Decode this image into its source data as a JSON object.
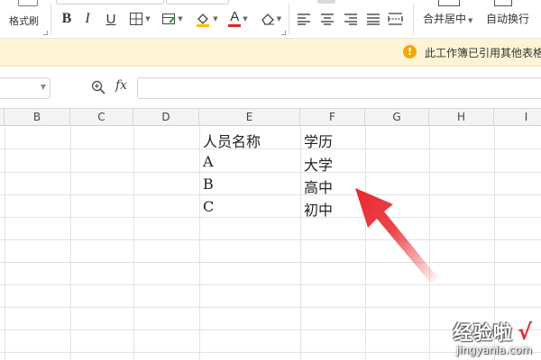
{
  "ribbon": {
    "format_painter_label": "格式刷",
    "bold_label": "B",
    "italic_label": "I",
    "underline_label": "U",
    "font_color_label": "A",
    "font_color": "#e02020",
    "merge_center_label": "合并居中",
    "wrap_text_label": "自动换行",
    "icons": [
      "format-painter-icon",
      "border-icon",
      "cell-style-icon",
      "fill-color-icon",
      "font-color-icon",
      "clear-icon",
      "align-left-icon",
      "align-center-icon",
      "align-right-icon",
      "justify-icon",
      "distribute-icon",
      "merge-icon",
      "wrap-icon"
    ]
  },
  "notice": {
    "text": "此工作簿已引用其他表格",
    "icon": "warning-icon",
    "icon_color": "#f2a900",
    "bg_color": "#fdf4d6"
  },
  "formula_bar": {
    "name_box_value": "",
    "fx_label": "fx",
    "formula_value": ""
  },
  "sheet": {
    "columns": [
      "B",
      "C",
      "D",
      "E",
      "F",
      "G",
      "H",
      "I"
    ],
    "cells": {
      "E1": "人员名称",
      "F1": "学历",
      "E2": "A",
      "F2": "大学",
      "E3": "B",
      "F3": "高中",
      "E4": "C",
      "F4": "初中"
    }
  },
  "annotation": {
    "arrow_color": "#e8262d"
  },
  "watermark": {
    "title": "经验啦",
    "check": "√",
    "url": "jingyanla.com"
  }
}
